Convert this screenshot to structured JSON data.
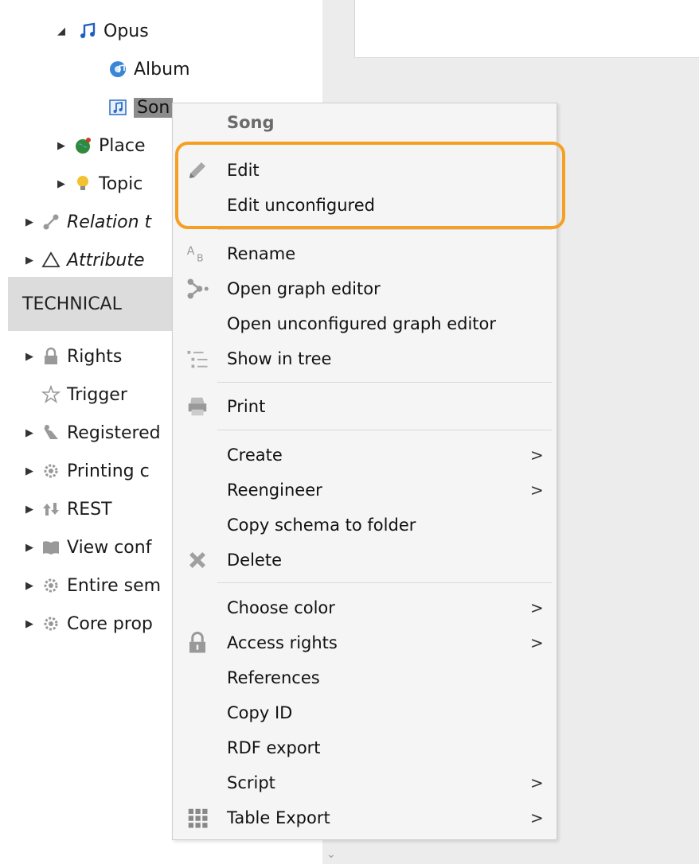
{
  "tree": {
    "items": [
      {
        "label": "Opus"
      },
      {
        "label": "Album"
      },
      {
        "label": "Son"
      },
      {
        "label": "Place"
      },
      {
        "label": "Topic"
      },
      {
        "label": "Relation t"
      },
      {
        "label": "Attribute"
      },
      {
        "label": "Rights"
      },
      {
        "label": "Trigger"
      },
      {
        "label": "Registered"
      },
      {
        "label": "Printing c"
      },
      {
        "label": "REST"
      },
      {
        "label": "View conf"
      },
      {
        "label": "Entire sem"
      },
      {
        "label": "Core prop"
      }
    ],
    "section_header": "TECHNICAL"
  },
  "context_menu": {
    "title": "Song",
    "items": [
      {
        "label": "Edit",
        "icon": "pencil-icon"
      },
      {
        "label": "Edit unconfigured"
      },
      {
        "label": "Rename",
        "icon": "rename-ab-icon"
      },
      {
        "label": "Open graph editor",
        "icon": "graph-icon"
      },
      {
        "label": "Open unconfigured graph editor"
      },
      {
        "label": "Show in tree",
        "icon": "tree-icon"
      },
      {
        "label": "Print",
        "icon": "print-icon"
      },
      {
        "label": "Create",
        "submenu": ">"
      },
      {
        "label": "Reengineer",
        "submenu": ">"
      },
      {
        "label": "Copy schema to folder"
      },
      {
        "label": "Delete",
        "icon": "delete-x-icon"
      },
      {
        "label": "Choose color",
        "submenu": ">"
      },
      {
        "label": "Access rights",
        "icon": "lock-icon",
        "submenu": ">"
      },
      {
        "label": "References"
      },
      {
        "label": "Copy ID"
      },
      {
        "label": "RDF export"
      },
      {
        "label": "Script",
        "submenu": ">"
      },
      {
        "label": "Table Export",
        "icon": "grid-icon",
        "submenu": ">"
      }
    ],
    "highlight_color": "#f5a023"
  },
  "scroll": {
    "chevron": "⌄"
  }
}
